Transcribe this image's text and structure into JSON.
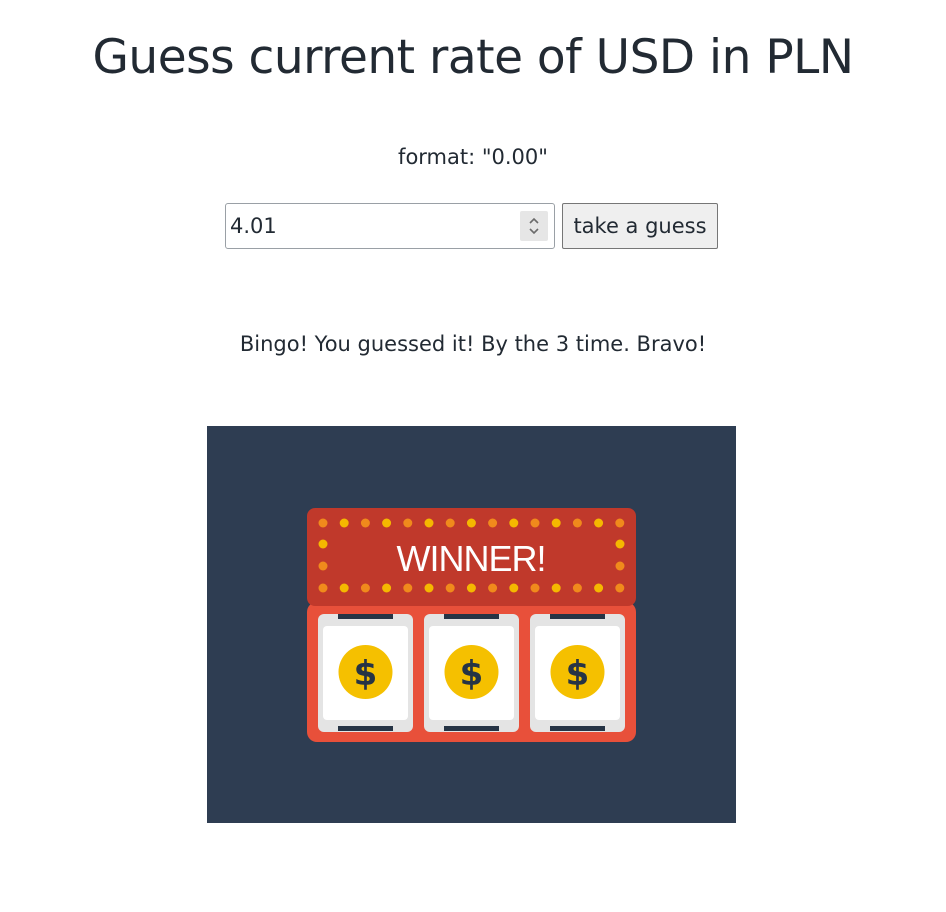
{
  "page": {
    "title": "Guess current rate of USD in PLN",
    "format_hint": "format: \"0.00\""
  },
  "guess_form": {
    "input_value": "4.01",
    "button_label": "take a guess"
  },
  "result": {
    "message": "Bingo! You guessed it! By the 3 time. Bravo!"
  },
  "winner_image": {
    "banner_text": "WINNER!",
    "reel_symbol": "$",
    "colors": {
      "background": "#2e3d52",
      "banner": "#c0392b",
      "machine": "#e8503a",
      "bulb": "#f5b800",
      "coin": "#f5c000",
      "reel": "#ffffff",
      "reel_shadow": "#e4e4e4",
      "reel_bar": "#263445"
    }
  }
}
